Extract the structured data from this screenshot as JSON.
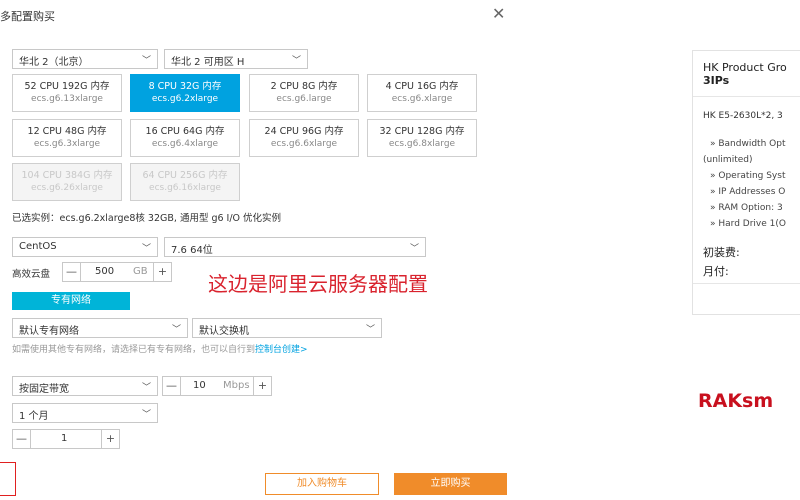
{
  "dialog": {
    "title": "多配置购买",
    "region": "华北 2（北京）",
    "zone": "华北 2 可用区 H",
    "specs": [
      {
        "line1": "52 CPU  192G 内存",
        "line2": "ecs.g6.13xlarge",
        "state": "normal"
      },
      {
        "line1": "8 CPU   32G 内存",
        "line2": "ecs.g6.2xlarge",
        "state": "selected"
      },
      {
        "line1": "2 CPU    8G 内存",
        "line2": "ecs.g6.large",
        "state": "normal"
      },
      {
        "line1": "4 CPU   16G 内存",
        "line2": "ecs.g6.xlarge",
        "state": "normal"
      },
      {
        "line1": "12 CPU  48G 内存",
        "line2": "ecs.g6.3xlarge",
        "state": "normal"
      },
      {
        "line1": "16 CPU  64G 内存",
        "line2": "ecs.g6.4xlarge",
        "state": "normal"
      },
      {
        "line1": "24 CPU  96G 内存",
        "line2": "ecs.g6.6xlarge",
        "state": "normal"
      },
      {
        "line1": "32 CPU  128G 内存",
        "line2": "ecs.g6.8xlarge",
        "state": "normal"
      },
      {
        "line1": "104 CPU 384G 内存",
        "line2": "ecs.g6.26xlarge",
        "state": "disabled"
      },
      {
        "line1": "64 CPU  256G 内存",
        "line2": "ecs.g6.16xlarge",
        "state": "disabled"
      }
    ],
    "selected_instance": "已选实例：ecs.g6.2xlarge8核 32GB, 通用型 g6 I/O 优化实例",
    "os": "CentOS",
    "os_version": "7.6 64位",
    "disk_label": "高效云盘",
    "disk_size": "500",
    "disk_unit": "GB",
    "vpc_button": "专有网络",
    "vpc": "默认专有网络",
    "vswitch": "默认交换机",
    "hint_text": "如需使用其他专有网络，请选择已有专有网络，也可以自行到",
    "hint_link": "控制台创建>",
    "bandwidth_mode": "按固定带宽",
    "bandwidth_value": "10",
    "bandwidth_unit": "Mbps",
    "duration": "1 个月",
    "quantity": "1",
    "add_to_cart": "加入购物车",
    "buy_now": "立即购买"
  },
  "annotation": "这边是阿里云服务器配置",
  "product_card": {
    "title": "HK Product Gro",
    "subtitle": "3IPs",
    "cpu": "HK E5-2630L*2, 3",
    "options": [
      "» Bandwidth Opt",
      "(unlimited)",
      "» Operating Syst",
      "» IP Addresses O",
      "» RAM Option: 3",
      "» Hard Drive 1(O"
    ],
    "setup_fee_label": "初装费:",
    "monthly_label": "月付:"
  },
  "brand": "RAKsm"
}
